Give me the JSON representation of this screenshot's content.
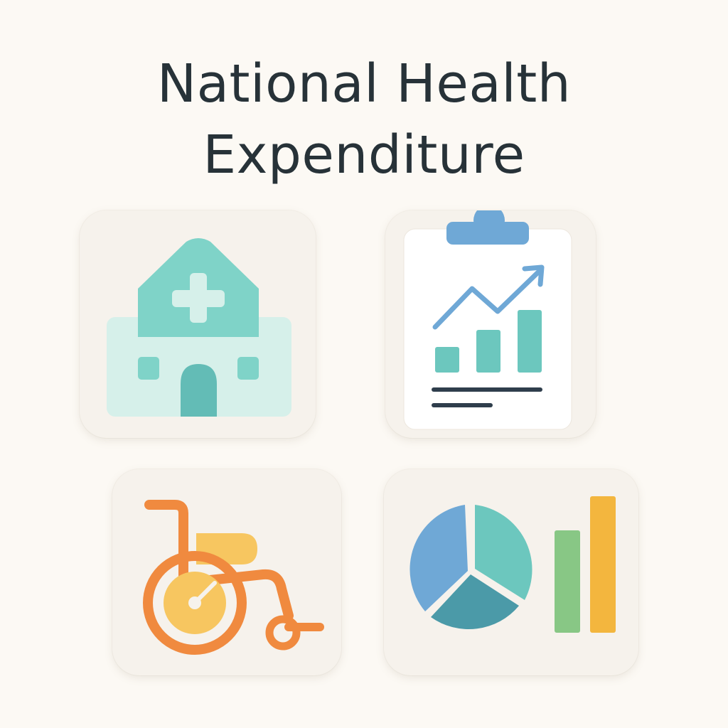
{
  "title": {
    "line1": "National Health",
    "line2": "Expenditure"
  },
  "icons": {
    "hospital": "hospital-icon",
    "report": "clipboard-trend-chart-icon",
    "wheelchair": "wheelchair-icon",
    "charts": "pie-and-bar-chart-icon"
  },
  "colors": {
    "background": "#fcf9f4",
    "tile": "#f6f2ec",
    "title_text": "#273238",
    "teal": "#6cc7be",
    "mint": "#d6f0ea",
    "blue": "#6fa8d6",
    "dark_teal": "#4b9aa8",
    "orange": "#f08a3f",
    "yellow": "#f7c660",
    "green": "#88c785",
    "amber": "#f3b63e",
    "navy": "#2f3e4c"
  }
}
